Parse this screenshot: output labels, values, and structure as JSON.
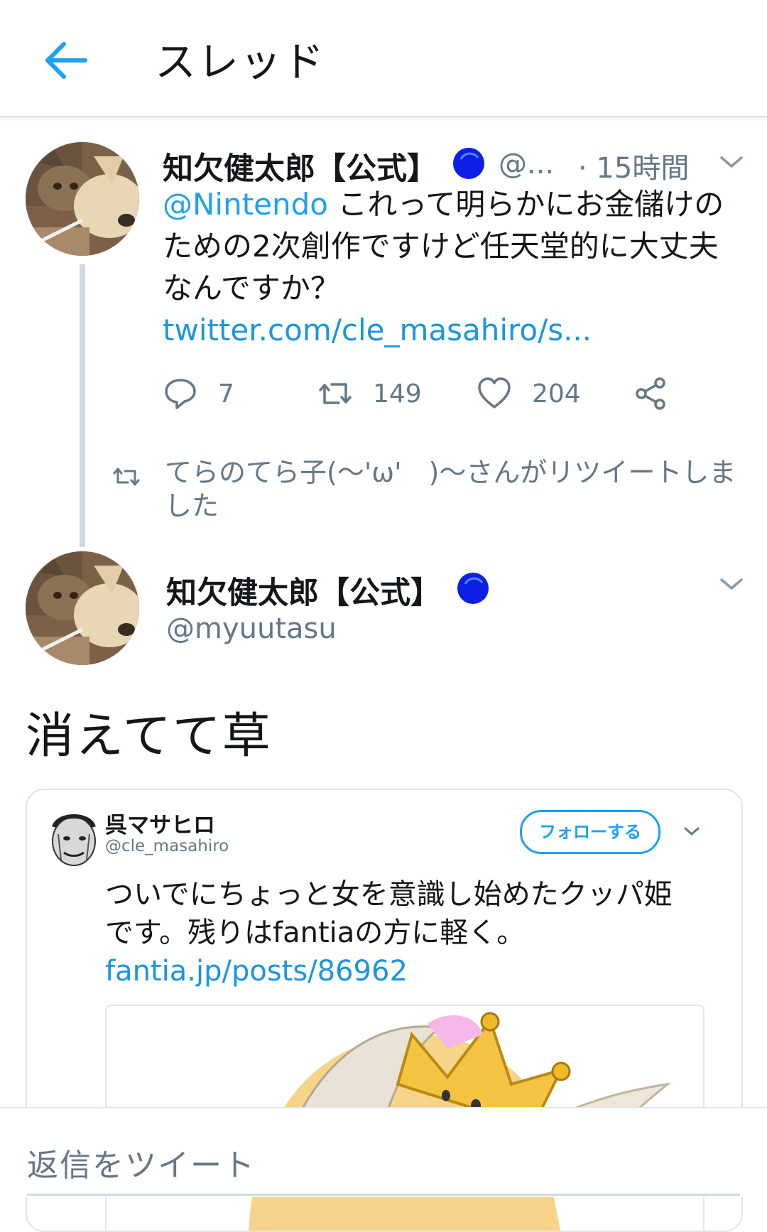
{
  "header": {
    "title": "スレッド"
  },
  "tweet1": {
    "name": "知欠健太郎【公式】",
    "handle": "@...",
    "time": "· 15時間",
    "mention": "@Nintendo",
    "text": " これって明らかにお金儲けのための2次創作ですけど任天堂的に大丈夫なんですか？",
    "link": "twitter.com/cle_masahiro/s...",
    "reply_count": "7",
    "retweet_count": "149",
    "like_count": "204"
  },
  "retweet_note": "てらのてら子(〜'ω'　)〜さんがリツイートしました",
  "tweet2": {
    "name": "知欠健太郎【公式】",
    "handle": "@myuutasu",
    "text": "消えてて草"
  },
  "embedded_tweet": {
    "name": "呉マサヒロ",
    "handle": "@cle_masahiro",
    "follow_label": "フォローする",
    "text": "ついでにちょっと女を意識し始めたクッパ姫です。残りはfantiaの方に軽く。",
    "link": "fantia.jp/posts/86962"
  },
  "reply_bar": {
    "placeholder": "返信をツイート"
  },
  "colors": {
    "accent": "#1da1f2",
    "verified": "#0d1fe6",
    "muted": "#657786"
  }
}
